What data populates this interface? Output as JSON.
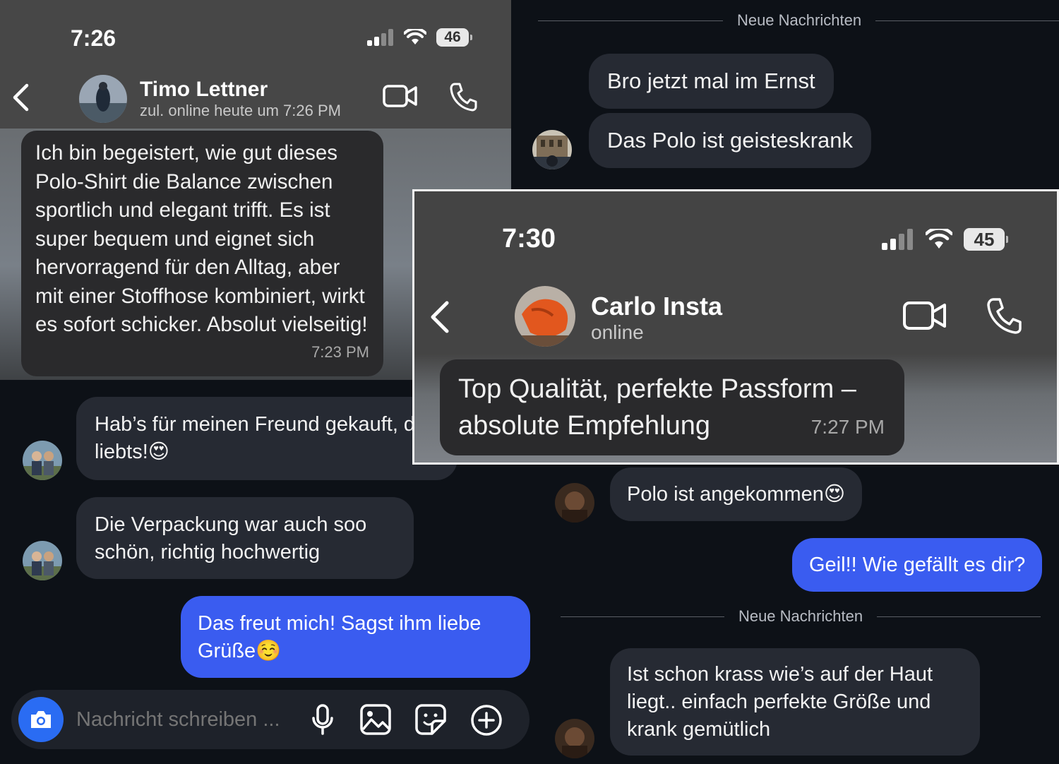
{
  "timo_chat": {
    "time": "7:26",
    "battery": "46",
    "contact_name": "Timo Lettner",
    "contact_status": "zul. online heute um 7:26 PM",
    "message": {
      "text": "Ich bin begeistert, wie gut dieses Polo-Shirt die Balance zwischen sportlich und elegant trifft. Es ist super bequem und eignet sich hervorragend für den Alltag, aber mit einer Stoffhose kombiniert, wirkt es sofort schicker. Absolut vielseitig!",
      "time": "7:23 PM"
    }
  },
  "insta_top_right": {
    "divider": "Neue Nachrichten",
    "messages": [
      {
        "text": "Bro jetzt mal im Ernst"
      },
      {
        "text": "Das Polo ist geisteskrank"
      }
    ]
  },
  "insta_bottom_left": {
    "messages": [
      {
        "text": "Hab’s für meinen Freund gekauft, der liebts!😍"
      },
      {
        "text": "Die Verpackung war auch soo schön, richtig hochwertig"
      }
    ],
    "my_message": "Das freut mich! Sagst ihm liebe Grüße☺️",
    "composer": {
      "placeholder": "Nachricht schreiben ..."
    }
  },
  "insta_bottom_right": {
    "message_1": "Polo ist angekommen😍",
    "my_message": "Geil!! Wie gefällt es dir?",
    "divider": "Neue Nachrichten",
    "message_2": "Ist schon krass wie’s auf der Haut liegt.. einfach perfekte Größe und krank gemütlich"
  },
  "carlo_chat": {
    "time": "7:30",
    "battery": "45",
    "contact_name": "Carlo Insta",
    "contact_status": "online",
    "message": {
      "text": "Top Qualität, perfekte Passform – absolute Empfehlung",
      "time": "7:27 PM"
    }
  },
  "colors": {
    "ig_bubble": "#262a33",
    "ig_mine": "#3a5cf0",
    "wa_bubble": "#2a2a2c",
    "wa_header": "#474747"
  },
  "icons": [
    "back-chevron-icon",
    "video-call-icon",
    "phone-icon",
    "signal-icon",
    "wifi-icon",
    "camera-icon",
    "microphone-icon",
    "gallery-icon",
    "sticker-icon",
    "plus-icon"
  ]
}
